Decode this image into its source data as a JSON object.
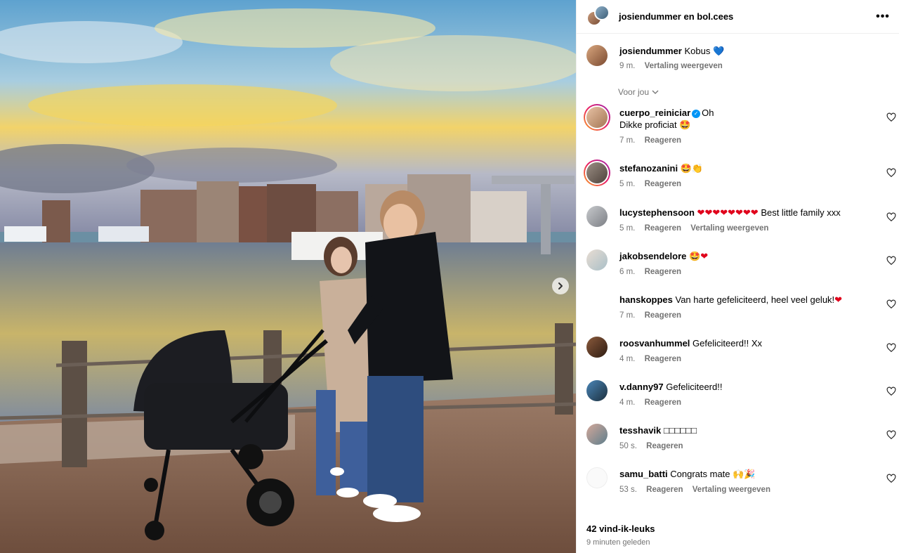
{
  "header": {
    "title": "josiendummer en bol.cees",
    "more_label": "•••"
  },
  "caption": {
    "user": "josiendummer",
    "text": "Kobus",
    "emoji": "💙",
    "time": "9 m.",
    "translate": "Vertaling weergeven"
  },
  "filter": {
    "label": "Voor jou"
  },
  "comments": [
    {
      "user": "cuerpo_reiniciar",
      "verified": true,
      "text": "Oh",
      "text2": "Dikke proficiat",
      "emoji2": "🤩",
      "time": "7 m.",
      "reply": "Reageren",
      "ring": true
    },
    {
      "user": "stefanozanini",
      "text": "",
      "emoji": "🤩👏",
      "time": "5 m.",
      "reply": "Reageren",
      "ring": true
    },
    {
      "user": "lucystephensoon",
      "hearts": "❤❤❤❤❤❤❤❤",
      "text": "Best little family xxx",
      "time": "5 m.",
      "reply": "Reageren",
      "translate": "Vertaling weergeven"
    },
    {
      "user": "jakobsendelore",
      "emoji": "🤩",
      "hearts": "❤",
      "time": "6 m.",
      "reply": "Reageren"
    },
    {
      "user": "hanskoppes",
      "text": "Van harte gefeliciteerd, heel veel geluk!",
      "hearts": "❤",
      "time": "7 m.",
      "reply": "Reageren"
    },
    {
      "user": "roosvanhummel",
      "text": "Gefeliciteerd!! Xx",
      "time": "4 m.",
      "reply": "Reageren"
    },
    {
      "user": "v.danny97",
      "text": "Gefeliciteerd!!",
      "time": "4 m.",
      "reply": "Reageren"
    },
    {
      "user": "tesshavik",
      "text": "□□□□□□",
      "time": "50 s.",
      "reply": "Reageren"
    },
    {
      "user": "samu_batti",
      "text": "Congrats mate",
      "emoji": "🙌🎉",
      "time": "53 s.",
      "reply": "Reageren",
      "translate": "Vertaling weergeven"
    }
  ],
  "footer": {
    "likes": "42 vind-ik-leuks",
    "time_ago": "9 minuten geleden"
  },
  "colors": {
    "heart_red": "#e0001b",
    "blue_heart": "#1d6fd8",
    "meta_gray": "#737373",
    "verified_blue": "#0095f6"
  }
}
